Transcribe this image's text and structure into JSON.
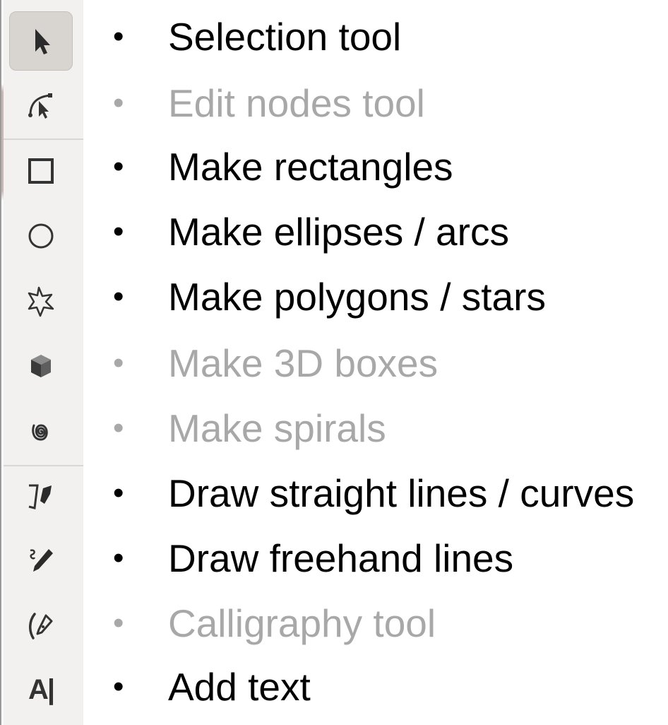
{
  "colors": {
    "enabled_text": "#000000",
    "disabled_text": "#a8a8a8",
    "toolbar_bg": "#f2f1f0",
    "active_tool_bg": "#d8d4cf"
  },
  "bullet_char": "•",
  "tools": [
    {
      "icon": "pointer-arrow-icon",
      "label": "Selection tool",
      "enabled": true,
      "active": true
    },
    {
      "icon": "node-edit-icon",
      "label": "Edit nodes tool",
      "enabled": false,
      "active": false
    },
    {
      "icon": "rectangle-icon",
      "label": "Make rectangles",
      "enabled": true,
      "active": false
    },
    {
      "icon": "ellipse-icon",
      "label": "Make ellipses / arcs",
      "enabled": true,
      "active": false
    },
    {
      "icon": "star-polygon-icon",
      "label": "Make polygons / stars",
      "enabled": true,
      "active": false
    },
    {
      "icon": "3d-box-icon",
      "label": "Make 3D boxes",
      "enabled": false,
      "active": false
    },
    {
      "icon": "spiral-icon",
      "label": "Make spirals",
      "enabled": false,
      "active": false
    },
    {
      "icon": "bezier-pen-icon",
      "label": "Draw straight lines / curves",
      "enabled": true,
      "active": false
    },
    {
      "icon": "pencil-icon",
      "label": "Draw freehand lines",
      "enabled": true,
      "active": false
    },
    {
      "icon": "calligraphy-pen-icon",
      "label": "Calligraphy tool",
      "enabled": false,
      "active": false
    },
    {
      "icon": "text-tool-icon",
      "icon_text": "A|",
      "label": "Add text",
      "enabled": true,
      "active": false
    }
  ]
}
